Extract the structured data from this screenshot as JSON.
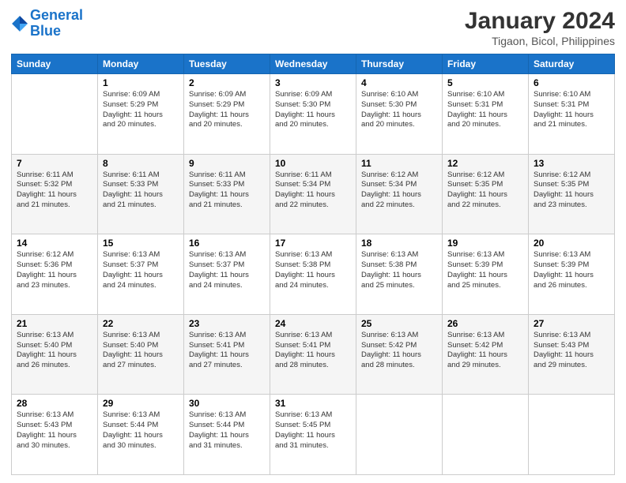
{
  "header": {
    "logo_line1": "General",
    "logo_line2": "Blue",
    "main_title": "January 2024",
    "subtitle": "Tigaon, Bicol, Philippines"
  },
  "days_of_week": [
    "Sunday",
    "Monday",
    "Tuesday",
    "Wednesday",
    "Thursday",
    "Friday",
    "Saturday"
  ],
  "weeks": [
    [
      {
        "day": "",
        "info": ""
      },
      {
        "day": "1",
        "info": "Sunrise: 6:09 AM\nSunset: 5:29 PM\nDaylight: 11 hours\nand 20 minutes."
      },
      {
        "day": "2",
        "info": "Sunrise: 6:09 AM\nSunset: 5:29 PM\nDaylight: 11 hours\nand 20 minutes."
      },
      {
        "day": "3",
        "info": "Sunrise: 6:09 AM\nSunset: 5:30 PM\nDaylight: 11 hours\nand 20 minutes."
      },
      {
        "day": "4",
        "info": "Sunrise: 6:10 AM\nSunset: 5:30 PM\nDaylight: 11 hours\nand 20 minutes."
      },
      {
        "day": "5",
        "info": "Sunrise: 6:10 AM\nSunset: 5:31 PM\nDaylight: 11 hours\nand 20 minutes."
      },
      {
        "day": "6",
        "info": "Sunrise: 6:10 AM\nSunset: 5:31 PM\nDaylight: 11 hours\nand 21 minutes."
      }
    ],
    [
      {
        "day": "7",
        "info": "Sunrise: 6:11 AM\nSunset: 5:32 PM\nDaylight: 11 hours\nand 21 minutes."
      },
      {
        "day": "8",
        "info": "Sunrise: 6:11 AM\nSunset: 5:33 PM\nDaylight: 11 hours\nand 21 minutes."
      },
      {
        "day": "9",
        "info": "Sunrise: 6:11 AM\nSunset: 5:33 PM\nDaylight: 11 hours\nand 21 minutes."
      },
      {
        "day": "10",
        "info": "Sunrise: 6:11 AM\nSunset: 5:34 PM\nDaylight: 11 hours\nand 22 minutes."
      },
      {
        "day": "11",
        "info": "Sunrise: 6:12 AM\nSunset: 5:34 PM\nDaylight: 11 hours\nand 22 minutes."
      },
      {
        "day": "12",
        "info": "Sunrise: 6:12 AM\nSunset: 5:35 PM\nDaylight: 11 hours\nand 22 minutes."
      },
      {
        "day": "13",
        "info": "Sunrise: 6:12 AM\nSunset: 5:35 PM\nDaylight: 11 hours\nand 23 minutes."
      }
    ],
    [
      {
        "day": "14",
        "info": "Sunrise: 6:12 AM\nSunset: 5:36 PM\nDaylight: 11 hours\nand 23 minutes."
      },
      {
        "day": "15",
        "info": "Sunrise: 6:13 AM\nSunset: 5:37 PM\nDaylight: 11 hours\nand 24 minutes."
      },
      {
        "day": "16",
        "info": "Sunrise: 6:13 AM\nSunset: 5:37 PM\nDaylight: 11 hours\nand 24 minutes."
      },
      {
        "day": "17",
        "info": "Sunrise: 6:13 AM\nSunset: 5:38 PM\nDaylight: 11 hours\nand 24 minutes."
      },
      {
        "day": "18",
        "info": "Sunrise: 6:13 AM\nSunset: 5:38 PM\nDaylight: 11 hours\nand 25 minutes."
      },
      {
        "day": "19",
        "info": "Sunrise: 6:13 AM\nSunset: 5:39 PM\nDaylight: 11 hours\nand 25 minutes."
      },
      {
        "day": "20",
        "info": "Sunrise: 6:13 AM\nSunset: 5:39 PM\nDaylight: 11 hours\nand 26 minutes."
      }
    ],
    [
      {
        "day": "21",
        "info": "Sunrise: 6:13 AM\nSunset: 5:40 PM\nDaylight: 11 hours\nand 26 minutes."
      },
      {
        "day": "22",
        "info": "Sunrise: 6:13 AM\nSunset: 5:40 PM\nDaylight: 11 hours\nand 27 minutes."
      },
      {
        "day": "23",
        "info": "Sunrise: 6:13 AM\nSunset: 5:41 PM\nDaylight: 11 hours\nand 27 minutes."
      },
      {
        "day": "24",
        "info": "Sunrise: 6:13 AM\nSunset: 5:41 PM\nDaylight: 11 hours\nand 28 minutes."
      },
      {
        "day": "25",
        "info": "Sunrise: 6:13 AM\nSunset: 5:42 PM\nDaylight: 11 hours\nand 28 minutes."
      },
      {
        "day": "26",
        "info": "Sunrise: 6:13 AM\nSunset: 5:42 PM\nDaylight: 11 hours\nand 29 minutes."
      },
      {
        "day": "27",
        "info": "Sunrise: 6:13 AM\nSunset: 5:43 PM\nDaylight: 11 hours\nand 29 minutes."
      }
    ],
    [
      {
        "day": "28",
        "info": "Sunrise: 6:13 AM\nSunset: 5:43 PM\nDaylight: 11 hours\nand 30 minutes."
      },
      {
        "day": "29",
        "info": "Sunrise: 6:13 AM\nSunset: 5:44 PM\nDaylight: 11 hours\nand 30 minutes."
      },
      {
        "day": "30",
        "info": "Sunrise: 6:13 AM\nSunset: 5:44 PM\nDaylight: 11 hours\nand 31 minutes."
      },
      {
        "day": "31",
        "info": "Sunrise: 6:13 AM\nSunset: 5:45 PM\nDaylight: 11 hours\nand 31 minutes."
      },
      {
        "day": "",
        "info": ""
      },
      {
        "day": "",
        "info": ""
      },
      {
        "day": "",
        "info": ""
      }
    ]
  ]
}
